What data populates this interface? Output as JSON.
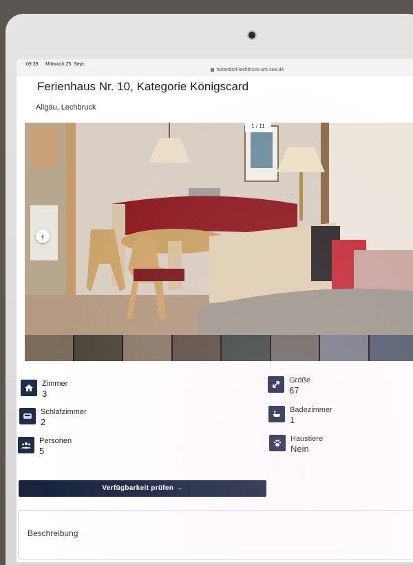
{
  "status": {
    "time": "09:39",
    "date": "Mittwoch 25. Sept."
  },
  "browser": {
    "url": "feriendorf-lechbruck-am-see.de"
  },
  "listing": {
    "title": "Ferienhaus Nr. 10, Kategorie Königscard",
    "location": "Allgäu, Lechbruck"
  },
  "gallery": {
    "counter": "1 / 11"
  },
  "features": [
    {
      "label": "Zimmer",
      "value": "3",
      "icon": "home-icon"
    },
    {
      "label": "Größe",
      "value": "67",
      "icon": "resize-arrows-icon"
    },
    {
      "label": "Schlafzimmer",
      "value": "2",
      "icon": "bed-icon"
    },
    {
      "label": "Badezimmer",
      "value": "1",
      "icon": "bathtub-icon"
    },
    {
      "label": "Personen",
      "value": "5",
      "icon": "people-group-icon"
    },
    {
      "label": "Haustiere",
      "value": "Nein",
      "icon": "paw-icon"
    }
  ],
  "actions": {
    "check_availability": "Verfügbarkeit prüfen →"
  },
  "sections": {
    "description": "Beschreibung"
  },
  "colors": {
    "accent": "#16243e",
    "icon_bg": "#1d2d4a"
  }
}
